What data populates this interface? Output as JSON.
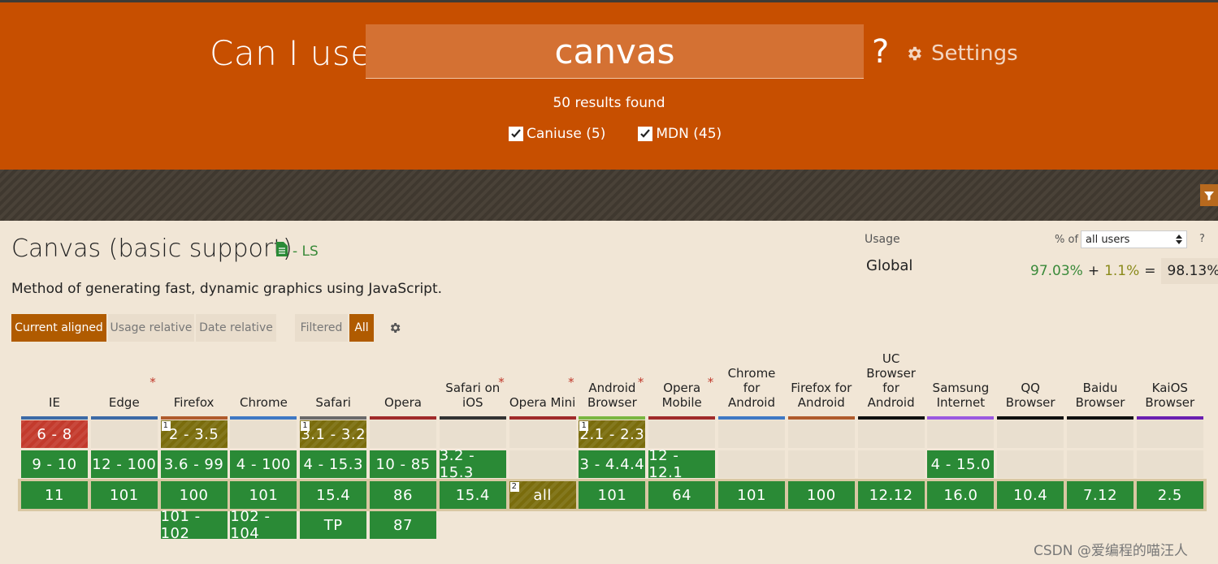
{
  "header": {
    "prefix": "Can I use",
    "search_value": "canvas",
    "help": "?",
    "settings_label": "Settings",
    "results": "50 results found",
    "filters": [
      {
        "label": "Caniuse (5)",
        "checked": true
      },
      {
        "label": "MDN (45)",
        "checked": true
      }
    ]
  },
  "feature": {
    "title": "Canvas (basic support)",
    "spec": "- LS",
    "description": "Method of generating fast, dynamic graphics using JavaScript."
  },
  "usage": {
    "label": "Usage",
    "pct_of": "% of",
    "select_value": "all users",
    "help": "?",
    "global_label": "Global",
    "supported": "97.03%",
    "plus": "+",
    "partial": "1.1%",
    "equals": "=",
    "total": "98.13%"
  },
  "toggles": {
    "current_aligned": "Current aligned",
    "usage_relative": "Usage relative",
    "date_relative": "Date relative",
    "filtered": "Filtered",
    "all": "All"
  },
  "colors": {
    "supported": "#2a8a36",
    "unsupported": "#c33a2c",
    "partial": "#7a6c0c",
    "header_bg": "#c74f00"
  },
  "browsers": [
    {
      "name": "IE",
      "color": "#3c6aa6",
      "asterisk": false,
      "cells": [
        {
          "v": "6 - 8",
          "s": "n"
        },
        {
          "v": "9 - 10",
          "s": "y"
        },
        {
          "v": "11",
          "s": "y"
        },
        null
      ]
    },
    {
      "name": "Edge",
      "color": "#3c6aa6",
      "asterisk": true,
      "cells": [
        {
          "v": "",
          "s": "u"
        },
        {
          "v": "12 - 100",
          "s": "y"
        },
        {
          "v": "101",
          "s": "y"
        },
        null
      ]
    },
    {
      "name": "Firefox",
      "color": "#b05b2c",
      "asterisk": false,
      "cells": [
        {
          "v": "2 - 3.5",
          "s": "p",
          "note": "1"
        },
        {
          "v": "3.6 - 99",
          "s": "y"
        },
        {
          "v": "100",
          "s": "y"
        },
        {
          "v": "101 - 102",
          "s": "y"
        }
      ]
    },
    {
      "name": "Chrome",
      "color": "#3f78c4",
      "asterisk": false,
      "cells": [
        {
          "v": "",
          "s": "u"
        },
        {
          "v": "4 - 100",
          "s": "y"
        },
        {
          "v": "101",
          "s": "y"
        },
        {
          "v": "102 - 104",
          "s": "y"
        }
      ]
    },
    {
      "name": "Safari",
      "color": "#6a6a6a",
      "asterisk": false,
      "cells": [
        {
          "v": "3.1 - 3.2",
          "s": "p",
          "note": "1"
        },
        {
          "v": "4 - 15.3",
          "s": "y"
        },
        {
          "v": "15.4",
          "s": "y"
        },
        {
          "v": "TP",
          "s": "y"
        }
      ]
    },
    {
      "name": "Opera",
      "color": "#a02a2a",
      "asterisk": false,
      "cells": [
        {
          "v": "",
          "s": "u"
        },
        {
          "v": "10 - 85",
          "s": "y"
        },
        {
          "v": "86",
          "s": "y"
        },
        {
          "v": "87",
          "s": "y"
        }
      ]
    },
    {
      "name": "Safari on iOS",
      "color": "#333333",
      "asterisk": true,
      "cells": [
        {
          "v": "",
          "s": "u"
        },
        {
          "v": "3.2 - 15.3",
          "s": "y"
        },
        {
          "v": "15.4",
          "s": "y"
        },
        null
      ]
    },
    {
      "name": "Opera Mini",
      "color": "#a02a2a",
      "asterisk": true,
      "cells": [
        {
          "v": "",
          "s": "u"
        },
        {
          "v": "",
          "s": "u"
        },
        {
          "v": "all",
          "s": "p",
          "note": "2"
        },
        null
      ]
    },
    {
      "name": "Android Browser",
      "color": "#7ab640",
      "asterisk": true,
      "cells": [
        {
          "v": "2.1 - 2.3",
          "s": "p",
          "note": "1"
        },
        {
          "v": "3 - 4.4.4",
          "s": "y"
        },
        {
          "v": "101",
          "s": "y"
        },
        null
      ]
    },
    {
      "name": "Opera Mobile",
      "color": "#a02a2a",
      "asterisk": true,
      "cells": [
        {
          "v": "",
          "s": "u"
        },
        {
          "v": "12 - 12.1",
          "s": "y"
        },
        {
          "v": "64",
          "s": "y"
        },
        null
      ]
    },
    {
      "name": "Chrome for Android",
      "color": "#3f78c4",
      "asterisk": false,
      "cells": [
        {
          "v": "",
          "s": "u"
        },
        {
          "v": "",
          "s": "u"
        },
        {
          "v": "101",
          "s": "y"
        },
        null
      ]
    },
    {
      "name": "Firefox for Android",
      "color": "#b05b2c",
      "asterisk": false,
      "cells": [
        {
          "v": "",
          "s": "u"
        },
        {
          "v": "",
          "s": "u"
        },
        {
          "v": "100",
          "s": "y"
        },
        null
      ]
    },
    {
      "name": "UC Browser for Android",
      "color": "#111111",
      "asterisk": false,
      "cells": [
        {
          "v": "",
          "s": "u"
        },
        {
          "v": "",
          "s": "u"
        },
        {
          "v": "12.12",
          "s": "y"
        },
        null
      ]
    },
    {
      "name": "Samsung Internet",
      "color": "#9b59e0",
      "asterisk": false,
      "cells": [
        {
          "v": "",
          "s": "u"
        },
        {
          "v": "4 - 15.0",
          "s": "y"
        },
        {
          "v": "16.0",
          "s": "y"
        },
        null
      ]
    },
    {
      "name": "QQ Browser",
      "color": "#111111",
      "asterisk": false,
      "cells": [
        {
          "v": "",
          "s": "u"
        },
        {
          "v": "",
          "s": "u"
        },
        {
          "v": "10.4",
          "s": "y"
        },
        null
      ]
    },
    {
      "name": "Baidu Browser",
      "color": "#111111",
      "asterisk": false,
      "cells": [
        {
          "v": "",
          "s": "u"
        },
        {
          "v": "",
          "s": "u"
        },
        {
          "v": "7.12",
          "s": "y"
        },
        null
      ]
    },
    {
      "name": "KaiOS Browser",
      "color": "#6a1fb0",
      "asterisk": false,
      "cells": [
        {
          "v": "",
          "s": "u"
        },
        {
          "v": "",
          "s": "u"
        },
        {
          "v": "2.5",
          "s": "y"
        },
        null
      ]
    }
  ],
  "watermark": "CSDN @爱编程的喵汪人"
}
